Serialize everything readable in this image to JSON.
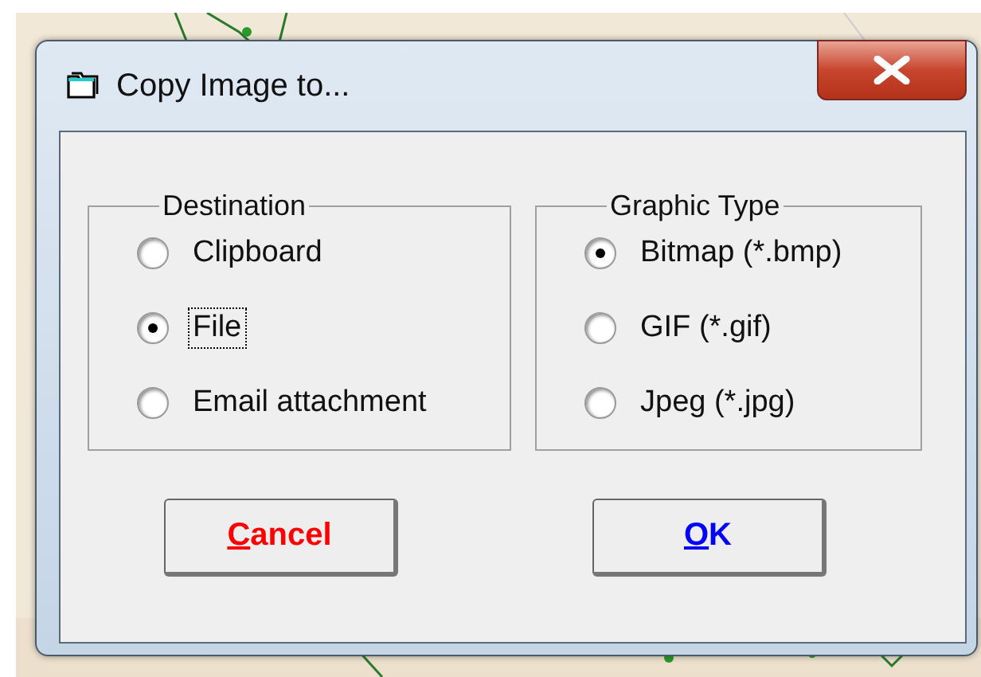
{
  "window": {
    "title": "Copy Image to..."
  },
  "groups": [
    {
      "title": "Destination",
      "options": [
        {
          "label": "Clipboard",
          "selected": false,
          "focused": false
        },
        {
          "label": "File",
          "selected": true,
          "focused": true
        },
        {
          "label": "Email attachment",
          "selected": false,
          "focused": false
        }
      ]
    },
    {
      "title": "Graphic Type",
      "options": [
        {
          "label": "Bitmap (*.bmp)",
          "selected": true,
          "focused": false
        },
        {
          "label": "GIF (*.gif)",
          "selected": false,
          "focused": false
        },
        {
          "label": "Jpeg (*.jpg)",
          "selected": false,
          "focused": false
        }
      ]
    }
  ],
  "buttons": [
    {
      "label": "Cancel",
      "color": "#ff0000",
      "mnemonic": true
    },
    {
      "label": "OK",
      "color": "#0000ff",
      "mnemonic": true
    }
  ]
}
